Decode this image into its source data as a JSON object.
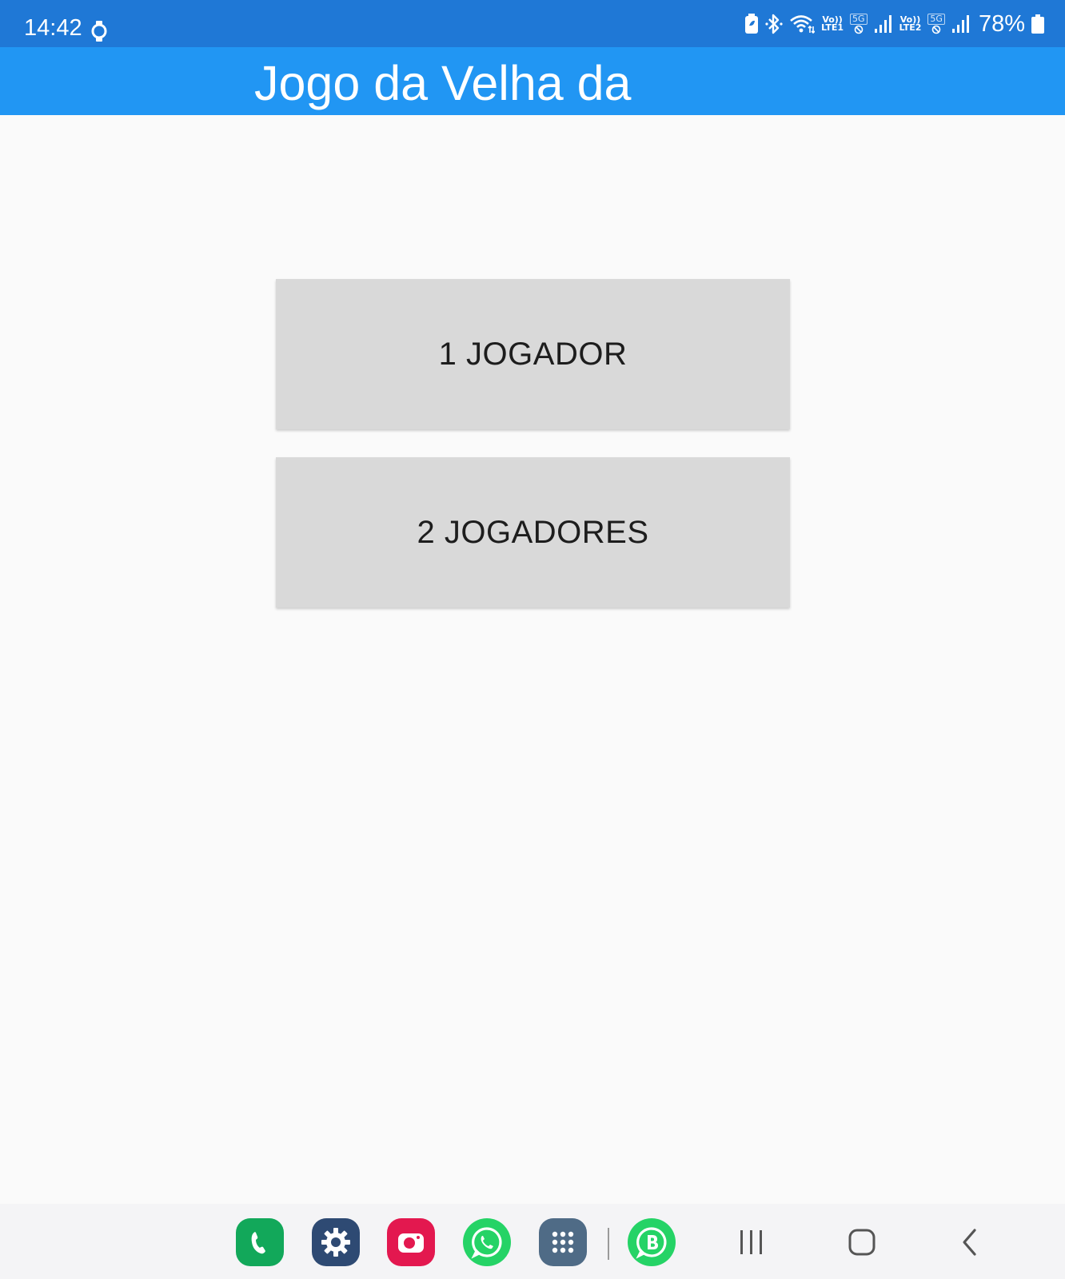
{
  "status_bar": {
    "time": "14:42",
    "network1_top": "Vo))",
    "network1_bottom": "LTE1",
    "network2_top": "Vo))",
    "network2_bottom": "LTE2",
    "badge_5g_1": "5G",
    "badge_5g_2": "5G",
    "battery_percent": "78%",
    "icons": [
      "watch-icon",
      "battery-saver-icon",
      "bluetooth-icon",
      "wifi-icon",
      "signal-icon",
      "signal-icon",
      "battery-icon"
    ]
  },
  "app_bar": {
    "title": "Jogo da Velha da",
    "color": "#2196f3"
  },
  "menu": {
    "one_player_label": "1 JOGADOR",
    "two_players_label": "2 JOGADORES"
  },
  "dock": {
    "apps": [
      "phone-app-icon",
      "settings-app-icon",
      "camera-app-icon",
      "whatsapp-app-icon",
      "app-drawer-icon",
      "whatsapp-business-app-icon"
    ],
    "nav": [
      "recent-apps-icon",
      "home-icon",
      "back-icon"
    ]
  }
}
